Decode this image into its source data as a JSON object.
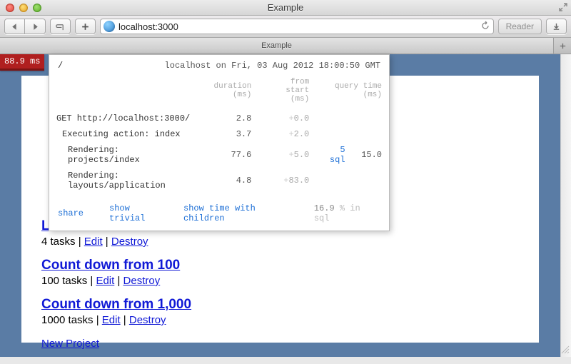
{
  "window": {
    "title": "Example"
  },
  "toolbar": {
    "url": "localhost:3000",
    "reader_label": "Reader"
  },
  "tab": {
    "label": "Example"
  },
  "profiler": {
    "badge_time": "88.9 ms",
    "path": "/",
    "timestamp": "localhost on Fri, 03 Aug 2012 18:00:50 GMT",
    "columns": {
      "duration": "duration (ms)",
      "from_start": "from start (ms)",
      "query_time": "query time (ms)"
    },
    "rows": [
      {
        "label": "GET http://localhost:3000/",
        "duration": "2.8",
        "from_start": "+0.0",
        "indent": 0
      },
      {
        "label": "Executing action: index",
        "duration": "3.7",
        "from_start": "+2.0",
        "indent": 1
      },
      {
        "label": "Rendering: projects/index",
        "duration": "77.6",
        "from_start": "+5.0",
        "sql_link": "5 sql",
        "query_time": "15.0",
        "indent": 2
      },
      {
        "label": "Rendering: layouts/application",
        "duration": "4.8",
        "from_start": "+83.0",
        "indent": 2
      }
    ],
    "footer": {
      "share": "share",
      "show_trivial": "show trivial",
      "show_children": "show time with children",
      "pct_value": "16.9",
      "pct_suffix": "% in sql"
    }
  },
  "page": {
    "projects": [
      {
        "title": "Learn Karate",
        "task_count": "4 tasks",
        "edit": "Edit",
        "destroy": "Destroy"
      },
      {
        "title": "Count down from 100",
        "task_count": "100 tasks",
        "edit": "Edit",
        "destroy": "Destroy"
      },
      {
        "title": "Count down from 1,000",
        "task_count": "1000 tasks",
        "edit": "Edit",
        "destroy": "Destroy"
      }
    ],
    "new_project": "New Project"
  }
}
